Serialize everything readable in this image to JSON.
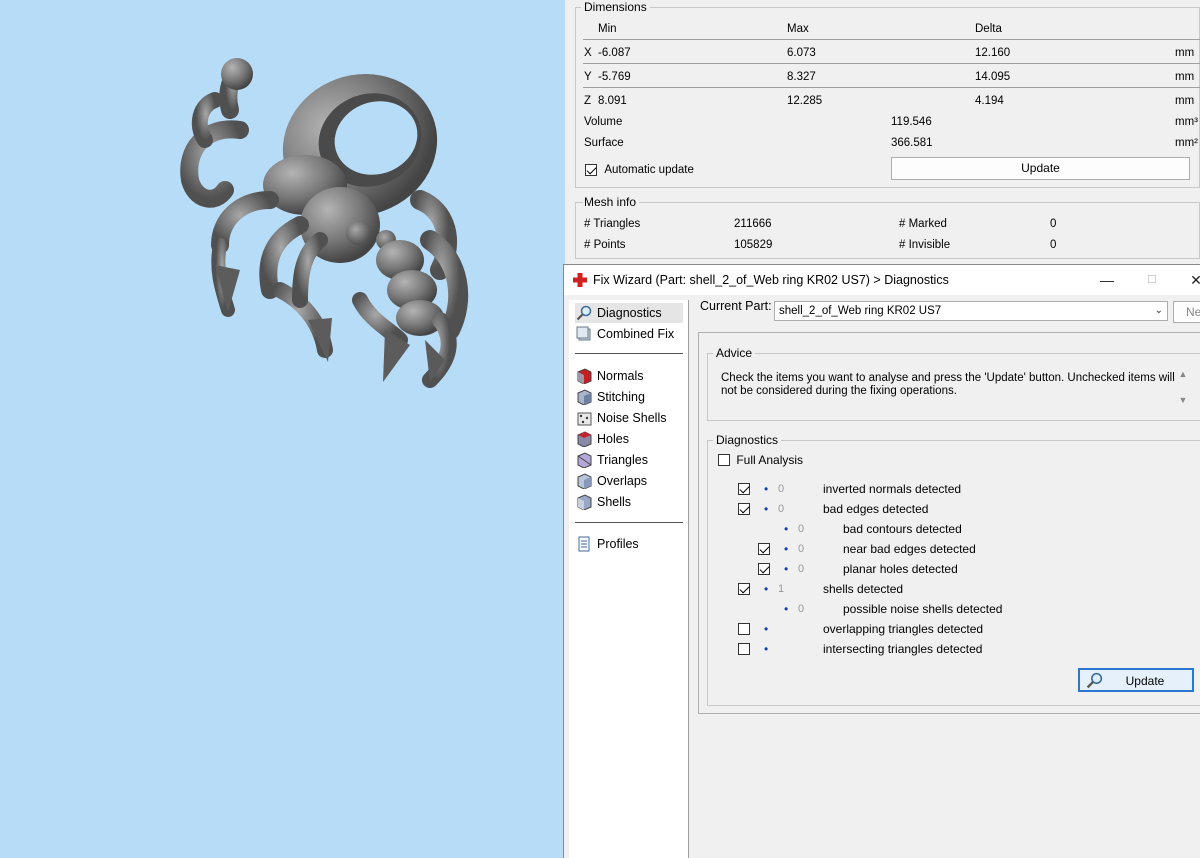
{
  "dimensions": {
    "legend": "Dimensions",
    "headers": {
      "min": "Min",
      "max": "Max",
      "delta": "Delta"
    },
    "rows": [
      {
        "axis": "X",
        "min": "-6.087",
        "max": "6.073",
        "delta": "12.160",
        "unit": "mm"
      },
      {
        "axis": "Y",
        "min": "-5.769",
        "max": "8.327",
        "delta": "14.095",
        "unit": "mm"
      },
      {
        "axis": "Z",
        "min": "8.091",
        "max": "12.285",
        "delta": "4.194",
        "unit": "mm"
      }
    ],
    "volume_label": "Volume",
    "volume_value": "119.546",
    "volume_unit": "mm³",
    "surface_label": "Surface",
    "surface_value": "366.581",
    "surface_unit": "mm²",
    "auto_update_label": "Automatic update",
    "auto_update_checked": true,
    "update_button": "Update"
  },
  "mesh_info": {
    "legend": "Mesh info",
    "triangles_label": "# Triangles",
    "triangles_value": "211666",
    "points_label": "# Points",
    "points_value": "105829",
    "marked_label": "# Marked",
    "marked_value": "0",
    "invisible_label": "# Invisible",
    "invisible_value": "0"
  },
  "wizard": {
    "title": "Fix Wizard (Part: shell_2_of_Web ring KR02 US7) > Diagnostics",
    "nav": [
      {
        "label": "Diagnostics",
        "icon": "magnifier-icon",
        "selected": true
      },
      {
        "label": "Combined Fix",
        "icon": "combined-fix-icon",
        "selected": false
      },
      {
        "label": "Normals",
        "icon": "normals-cube-icon",
        "selected": false
      },
      {
        "label": "Stitching",
        "icon": "stitching-cube-icon",
        "selected": false
      },
      {
        "label": "Noise Shells",
        "icon": "noise-shells-icon",
        "selected": false
      },
      {
        "label": "Holes",
        "icon": "holes-cube-icon",
        "selected": false
      },
      {
        "label": "Triangles",
        "icon": "triangles-icon",
        "selected": false
      },
      {
        "label": "Overlaps",
        "icon": "overlaps-icon",
        "selected": false
      },
      {
        "label": "Shells",
        "icon": "shells-icon",
        "selected": false
      },
      {
        "label": "Profiles",
        "icon": "profiles-document-icon",
        "selected": false
      }
    ],
    "current_part_label": "Current Part:",
    "current_part_value": "shell_2_of_Web ring KR02 US7",
    "next_button": "Nex",
    "advice_legend": "Advice",
    "advice_text": "Check the items you want to analyse and press the 'Update' button. Unchecked items will not be considered during the fixing operations.",
    "diagnostics_legend": "Diagnostics",
    "full_analysis_label": "Full Analysis",
    "full_analysis_checked": false,
    "items": [
      {
        "checkbox": true,
        "checked": true,
        "count": "0",
        "label": "inverted normals detected",
        "indent": 0
      },
      {
        "checkbox": true,
        "checked": true,
        "count": "0",
        "label": "bad edges detected",
        "indent": 0
      },
      {
        "checkbox": false,
        "checked": false,
        "count": "0",
        "label": "bad contours detected",
        "indent": 1
      },
      {
        "checkbox": true,
        "checked": true,
        "count": "0",
        "label": "near bad edges detected",
        "indent": 1
      },
      {
        "checkbox": true,
        "checked": true,
        "count": "0",
        "label": "planar holes detected",
        "indent": 1
      },
      {
        "checkbox": true,
        "checked": true,
        "count": "1",
        "label": "shells detected",
        "indent": 0
      },
      {
        "checkbox": false,
        "checked": false,
        "count": "0",
        "label": "possible noise shells detected",
        "indent": 1
      },
      {
        "checkbox": true,
        "checked": false,
        "count": "",
        "label": "overlapping triangles detected",
        "indent": 0
      },
      {
        "checkbox": true,
        "checked": false,
        "count": "",
        "label": "intersecting triangles detected",
        "indent": 0
      }
    ],
    "update_button": "Update"
  },
  "colors": {
    "viewport_bg": "#b7dcf8",
    "model_gray": "#6f6f6f",
    "wizard_icon_red": "#d02020",
    "bullet_blue": "#1040c0"
  }
}
